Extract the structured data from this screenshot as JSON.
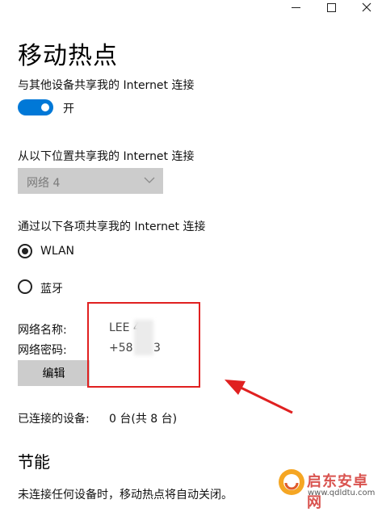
{
  "page": {
    "title": "移动热点"
  },
  "share": {
    "label": "与其他设备共享我的 Internet 连接",
    "toggle_state": "开",
    "toggle_on": true
  },
  "source": {
    "label": "从以下位置共享我的 Internet 连接",
    "selected": "网络 4"
  },
  "share_over": {
    "label": "通过以下各项共享我的 Internet 连接",
    "options": [
      {
        "label": "WLAN",
        "checked": true
      },
      {
        "label": "蓝牙",
        "checked": false
      }
    ]
  },
  "network": {
    "name_label": "网络名称:",
    "name_value": "LEE 4",
    "password_label": "网络密码:",
    "password_value": "+58",
    "password_suffix": "3",
    "edit_label": "编辑"
  },
  "devices": {
    "label": "已连接的设备:",
    "value": "0 台(共 8 台)"
  },
  "power": {
    "title": "节能",
    "text": "未连接任何设备时，移动热点将自动关闭。"
  },
  "watermark": {
    "brand": "启东安卓网",
    "url": "www.qdldtu.com"
  },
  "colors": {
    "accent": "#0078d7",
    "annotation": "#e02020",
    "control_bg": "#cccccc"
  }
}
